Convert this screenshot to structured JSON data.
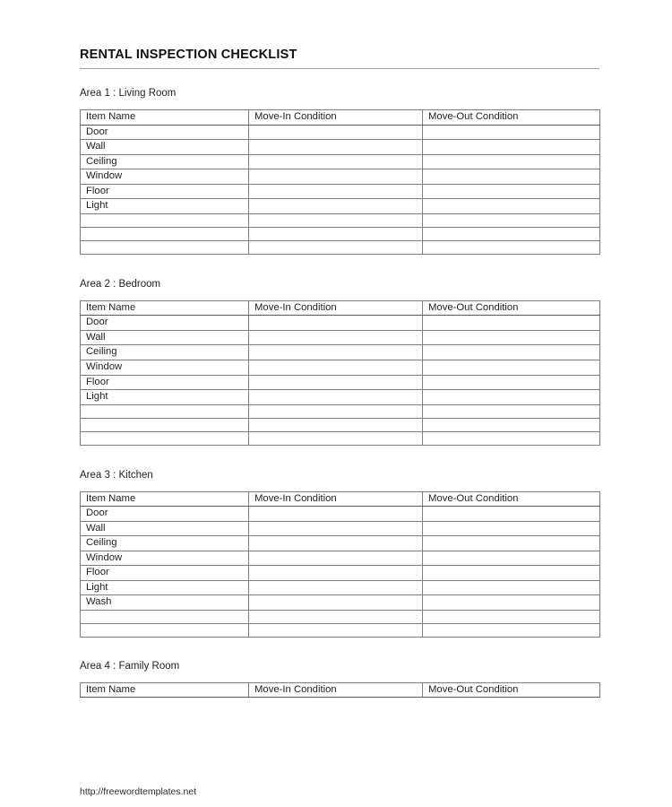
{
  "document": {
    "title": "RENTAL INSPECTION CHECKLIST",
    "footer_url": "http://freewordtemplates.net"
  },
  "table_headers": {
    "item_name": "Item Name",
    "move_in": "Move-In Condition",
    "move_out": "Move-Out Condition"
  },
  "areas": [
    {
      "label": "Area 1 : Living Room",
      "items": [
        "Door",
        "Wall",
        "Ceiling",
        "Window",
        "Floor",
        "Light"
      ],
      "empty_rows": 3
    },
    {
      "label": "Area 2 : Bedroom",
      "items": [
        "Door",
        "Wall",
        "Ceiling",
        "Window",
        "Floor",
        "Light"
      ],
      "empty_rows": 3
    },
    {
      "label": "Area 3 : Kitchen",
      "items": [
        "Door",
        "Wall",
        "Ceiling",
        "Window",
        "Floor",
        "Light",
        "Wash"
      ],
      "empty_rows": 2
    },
    {
      "label": "Area 4 : Family Room",
      "items": [],
      "empty_rows": 0
    }
  ],
  "colors": {
    "page_background": "#ffffff",
    "text": "#1f1f1f",
    "title_text": "#111111",
    "border": "#808080",
    "title_rule": "#a6a6a6"
  }
}
